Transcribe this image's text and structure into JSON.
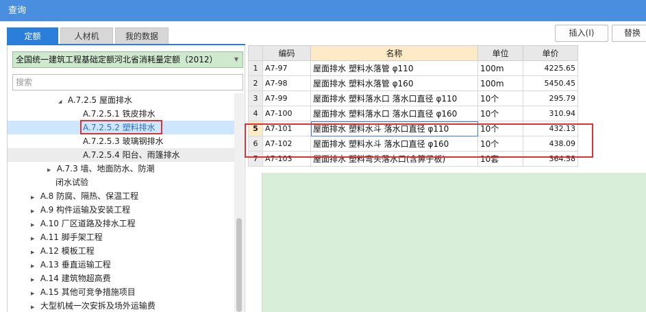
{
  "window": {
    "title": "查询"
  },
  "tabs": [
    {
      "label": "定额",
      "active": true
    },
    {
      "label": "人材机",
      "active": false
    },
    {
      "label": "我的数据",
      "active": false
    }
  ],
  "toolbar": {
    "insert_label": "插入(I)",
    "replace_label": "替换"
  },
  "quota_select": {
    "value": "全国统一建筑工程基础定额河北省消耗量定额（2012）"
  },
  "search": {
    "placeholder": "搜索"
  },
  "tree": [
    {
      "label": "A.7.2.5 屋面排水",
      "expander": "◢"
    },
    {
      "label": "A.7.2.5.1 铁皮排水",
      "expander": ""
    },
    {
      "label": "A.7.2.5.2 塑料排水",
      "expander": ""
    },
    {
      "label": "A.7.2.5.3 玻璃钢排水",
      "expander": ""
    },
    {
      "label": "A.7.2.5.4 阳台、雨篷排水",
      "expander": ""
    },
    {
      "label": "A.7.3 墙、地面防水、防潮",
      "expander": "▶"
    },
    {
      "label": "闭水试验",
      "expander": ""
    },
    {
      "label": "A.8 防腐、隔热、保温工程",
      "expander": "▶"
    },
    {
      "label": "A.9 构件运输及安装工程",
      "expander": "▶"
    },
    {
      "label": "A.10 厂区道路及排水工程",
      "expander": "▶"
    },
    {
      "label": "A.11 脚手架工程",
      "expander": "▶"
    },
    {
      "label": "A.12 模板工程",
      "expander": "▶"
    },
    {
      "label": "A.13 垂直运输工程",
      "expander": "▶"
    },
    {
      "label": "A.14 建筑物超高费",
      "expander": "▶"
    },
    {
      "label": "A.15 其他可竞争措施项目",
      "expander": "▶"
    },
    {
      "label": "大型机械一次安拆及场外运输费",
      "expander": "▶"
    }
  ],
  "table": {
    "headers": {
      "code": "编码",
      "name": "名称",
      "unit": "单位",
      "price": "单价"
    },
    "rows": [
      {
        "idx": "1",
        "code": "A7-97",
        "name": "屋面排水 塑料水落管 φ110",
        "unit": "100m",
        "price": "4225.65"
      },
      {
        "idx": "2",
        "code": "A7-98",
        "name": "屋面排水 塑料水落管 φ160",
        "unit": "100m",
        "price": "5450.45"
      },
      {
        "idx": "3",
        "code": "A7-99",
        "name": "屋面排水 塑料落水口 落水口直径 φ110",
        "unit": "10个",
        "price": "295.79"
      },
      {
        "idx": "4",
        "code": "A7-100",
        "name": "屋面排水 塑料落水口 落水口直径 φ160",
        "unit": "10个",
        "price": "310.94"
      },
      {
        "idx": "5",
        "code": "A7-101",
        "name": "屋面排水 塑料水斗 落水口直径 φ110",
        "unit": "10个",
        "price": "432.13"
      },
      {
        "idx": "6",
        "code": "A7-102",
        "name": "屋面排水 塑料水斗 落水口直径 φ160",
        "unit": "10个",
        "price": "438.09"
      },
      {
        "idx": "7",
        "code": "A7-103",
        "name": "屋面排水 塑料弯头落水口(含箅子板)",
        "unit": "10套",
        "price": "364.58"
      }
    ]
  },
  "colors": {
    "titlebar": "#4a8ee0",
    "tab_active": "#2b7fd9",
    "highlight": "#e03030",
    "grid_empty": "#d9eed9",
    "select_bg": "#cfe9cf"
  }
}
